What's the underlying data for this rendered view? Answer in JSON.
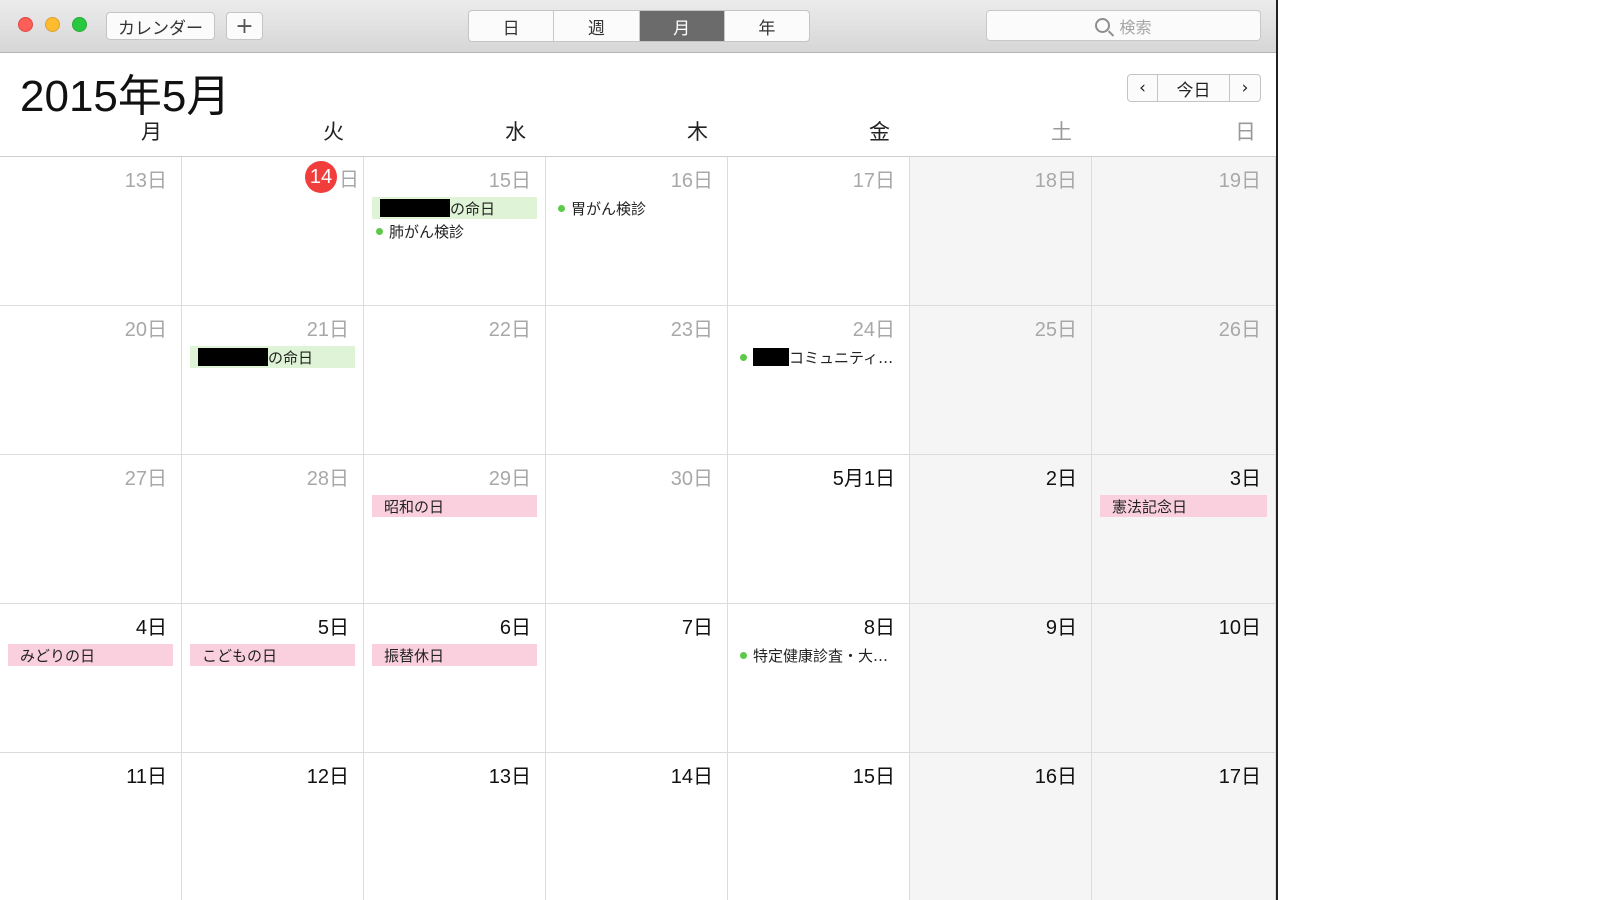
{
  "toolbar": {
    "calendars_label": "カレンダー",
    "add_label": "+"
  },
  "view_tabs": [
    {
      "label": "日",
      "active": false
    },
    {
      "label": "週",
      "active": false
    },
    {
      "label": "月",
      "active": true
    },
    {
      "label": "年",
      "active": false
    }
  ],
  "search": {
    "placeholder": "検索"
  },
  "header": {
    "month_title": "2015年5月"
  },
  "nav": {
    "prev": "‹",
    "today": "今日",
    "next": "›"
  },
  "weekdays": [
    "月",
    "火",
    "水",
    "木",
    "金",
    "土",
    "日"
  ],
  "colors": {
    "accent_today": "#f23d3d",
    "green_event": "#dff3d7",
    "pink_holiday": "#fad0de",
    "dot": "#5dc94a"
  },
  "weeks": [
    [
      {
        "label": "13日",
        "current": false
      },
      {
        "label": "14",
        "suffix": "日",
        "current": false,
        "today": true
      },
      {
        "label": "15日",
        "current": false,
        "events": [
          {
            "kind": "allday-green",
            "redacted": true,
            "text": "の命日"
          },
          {
            "kind": "timed",
            "text": "肺がん検診"
          }
        ]
      },
      {
        "label": "16日",
        "current": false,
        "events": [
          {
            "kind": "timed",
            "text": "胃がん検診"
          }
        ]
      },
      {
        "label": "17日",
        "current": false
      },
      {
        "label": "18日",
        "current": false,
        "weekend": true
      },
      {
        "label": "19日",
        "current": false,
        "weekend": true
      }
    ],
    [
      {
        "label": "20日",
        "current": false
      },
      {
        "label": "21日",
        "current": false,
        "events": [
          {
            "kind": "allday-green",
            "redacted": true,
            "text": "の命日"
          }
        ]
      },
      {
        "label": "22日",
        "current": false
      },
      {
        "label": "23日",
        "current": false
      },
      {
        "label": "24日",
        "current": false,
        "events": [
          {
            "kind": "timed",
            "redacted": true,
            "text": "コミュニティ…"
          }
        ]
      },
      {
        "label": "25日",
        "current": false,
        "weekend": true
      },
      {
        "label": "26日",
        "current": false,
        "weekend": true
      }
    ],
    [
      {
        "label": "27日",
        "current": false
      },
      {
        "label": "28日",
        "current": false
      },
      {
        "label": "29日",
        "current": false,
        "events": [
          {
            "kind": "allday-pink",
            "text": "昭和の日"
          }
        ]
      },
      {
        "label": "30日",
        "current": false
      },
      {
        "label": "5月1日",
        "current": true
      },
      {
        "label": "2日",
        "current": true,
        "weekend": true
      },
      {
        "label": "3日",
        "current": true,
        "weekend": true,
        "events": [
          {
            "kind": "allday-pink",
            "text": "憲法記念日"
          }
        ]
      }
    ],
    [
      {
        "label": "4日",
        "current": true,
        "events": [
          {
            "kind": "allday-pink",
            "text": "みどりの日"
          }
        ]
      },
      {
        "label": "5日",
        "current": true,
        "events": [
          {
            "kind": "allday-pink",
            "text": "こどもの日"
          }
        ]
      },
      {
        "label": "6日",
        "current": true,
        "events": [
          {
            "kind": "allday-pink",
            "text": "振替休日"
          }
        ]
      },
      {
        "label": "7日",
        "current": true
      },
      {
        "label": "8日",
        "current": true,
        "events": [
          {
            "kind": "timed",
            "text": "特定健康診査・大…"
          }
        ]
      },
      {
        "label": "9日",
        "current": true,
        "weekend": true
      },
      {
        "label": "10日",
        "current": true,
        "weekend": true
      }
    ],
    [
      {
        "label": "11日",
        "current": true
      },
      {
        "label": "12日",
        "current": true
      },
      {
        "label": "13日",
        "current": true
      },
      {
        "label": "14日",
        "current": true
      },
      {
        "label": "15日",
        "current": true
      },
      {
        "label": "16日",
        "current": true,
        "weekend": true
      },
      {
        "label": "17日",
        "current": true,
        "weekend": true
      }
    ]
  ]
}
